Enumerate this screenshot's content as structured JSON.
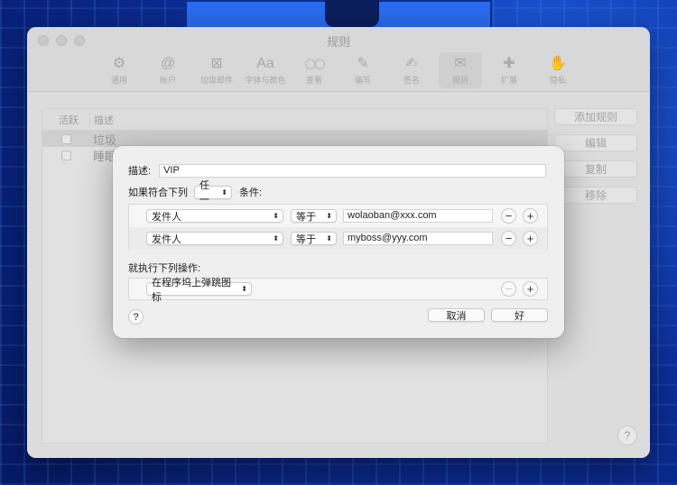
{
  "window": {
    "title": "规则",
    "toolbar": [
      {
        "icon": "gear-icon",
        "glyph": "⚙",
        "label": "通用"
      },
      {
        "icon": "at-icon",
        "glyph": "@",
        "label": "帐户"
      },
      {
        "icon": "junk-mail-icon",
        "glyph": "⊠",
        "label": "垃圾邮件"
      },
      {
        "icon": "fonts-icon",
        "glyph": "Aa",
        "label": "字体与颜色"
      },
      {
        "icon": "glasses-icon",
        "glyph": "◯◯",
        "label": "查看"
      },
      {
        "icon": "compose-icon",
        "glyph": "✎",
        "label": "编写"
      },
      {
        "icon": "signature-icon",
        "glyph": "✍",
        "label": "签名"
      },
      {
        "icon": "rules-icon",
        "glyph": "✉",
        "label": "规则",
        "active": true
      },
      {
        "icon": "puzzle-icon",
        "glyph": "✚",
        "label": "扩展"
      },
      {
        "icon": "hand-icon",
        "glyph": "✋",
        "label": "隐私"
      }
    ]
  },
  "rules_table": {
    "col_active": "活跃",
    "col_desc": "描述",
    "rows": [
      {
        "name": "垃圾",
        "selected": true
      },
      {
        "name": "睡眠",
        "selected": false
      }
    ]
  },
  "side_buttons": {
    "add": "添加规则",
    "edit": "编辑",
    "duplicate": "复制",
    "remove": "移除"
  },
  "help_label": "?",
  "sheet": {
    "desc_label": "描述:",
    "desc_value": "VIP",
    "if_label": "如果符合下列",
    "match_option": "任一",
    "conditions_label": "条件:",
    "conditions": [
      {
        "field": "发件人",
        "op": "等于",
        "value": "wolaoban@xxx.com"
      },
      {
        "field": "发件人",
        "op": "等于",
        "value": "myboss@yyy.com"
      }
    ],
    "actions_label": "就执行下列操作:",
    "action": "在程序坞上弹跳图标",
    "minus": "−",
    "plus": "+",
    "help": "?",
    "cancel": "取消",
    "ok": "好"
  }
}
